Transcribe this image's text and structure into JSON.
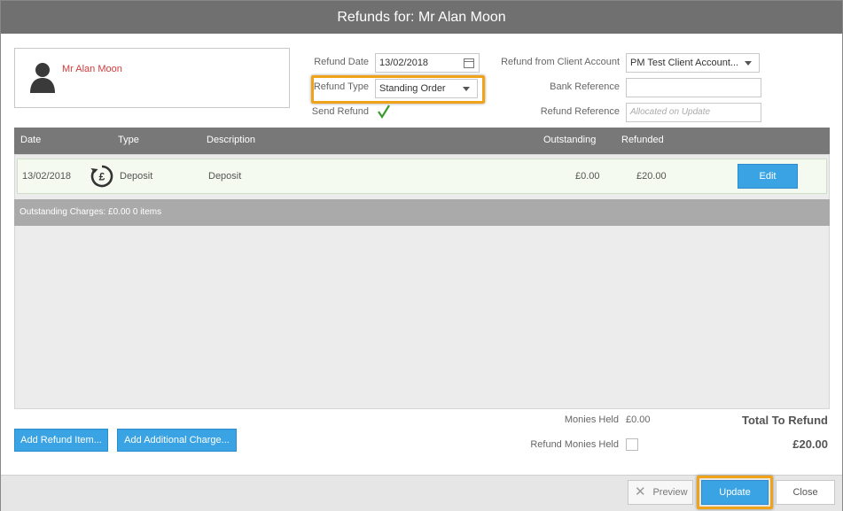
{
  "window": {
    "title": "Refunds for: Mr Alan Moon"
  },
  "client": {
    "name": "Mr Alan Moon"
  },
  "form": {
    "refund_date_label": "Refund Date",
    "refund_date_value": "13/02/2018",
    "refund_type_label": "Refund Type",
    "refund_type_value": "Standing Order",
    "send_refund_label": "Send Refund",
    "send_refund_checked": true,
    "refund_from_label": "Refund from Client Account",
    "refund_from_value": "PM Test Client Account...",
    "bank_reference_label": "Bank Reference",
    "bank_reference_value": "",
    "refund_reference_label": "Refund Reference",
    "refund_reference_placeholder": "Allocated on Update"
  },
  "grid": {
    "columns": [
      "Date",
      "Type",
      "Description",
      "Outstanding",
      "Refunded"
    ],
    "rows": [
      {
        "date": "13/02/2018",
        "type": "Deposit",
        "description": "Deposit",
        "outstanding": "£0.00",
        "refunded": "£20.00",
        "action": "Edit",
        "icon": "pound-refund-icon"
      }
    ],
    "summary": "Outstanding Charges: £0.00 0 items"
  },
  "actions": {
    "add_refund_item": "Add Refund Item...",
    "add_additional_charge": "Add Additional Charge..."
  },
  "totals": {
    "monies_held_label": "Monies Held",
    "monies_held_value": "£0.00",
    "refund_monies_held_label": "Refund Monies Held",
    "refund_monies_held_checked": false,
    "total_label": "Total To Refund",
    "total_value": "£20.00"
  },
  "footer": {
    "preview": "Preview",
    "update": "Update",
    "close": "Close"
  },
  "colors": {
    "accent": "#3aa3e3",
    "highlight": "#f0a218",
    "client_name": "#d13b3b",
    "header": "#707070"
  }
}
